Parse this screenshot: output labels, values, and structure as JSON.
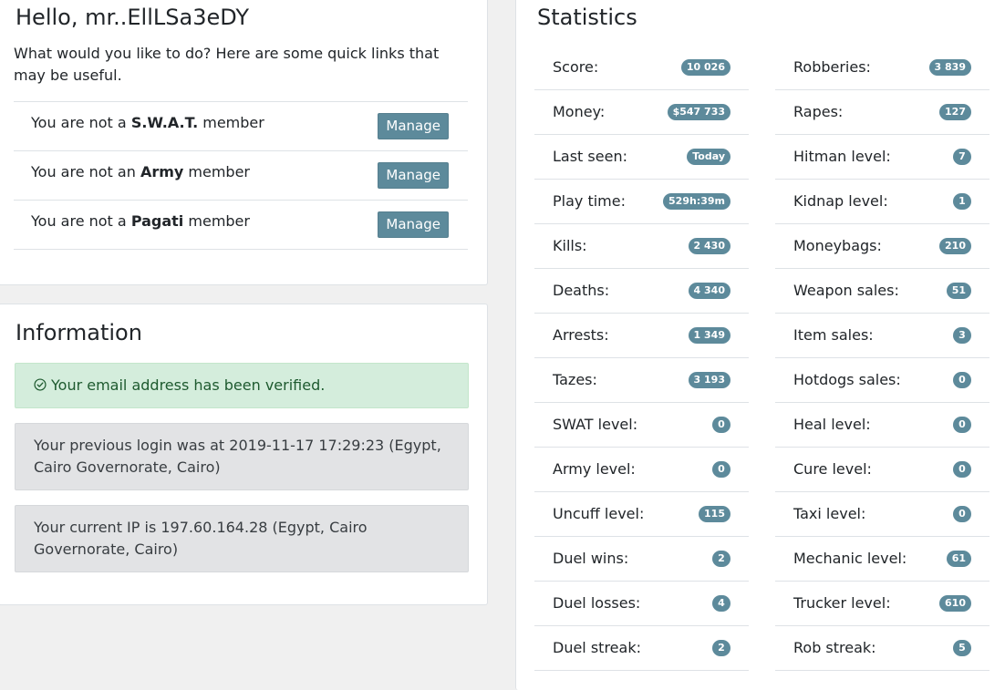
{
  "hello": {
    "title": "Hello, mr..EllLSa3eDY",
    "intro": "What would you like to do? Here are some quick links that may be useful.",
    "memberships": [
      {
        "prefix": "You are not a ",
        "group": "S.W.A.T.",
        "suffix": " member",
        "button": "Manage"
      },
      {
        "prefix": "You are not an ",
        "group": "Army",
        "suffix": " member",
        "button": "Manage"
      },
      {
        "prefix": "You are not a ",
        "group": "Pagati",
        "suffix": " member",
        "button": "Manage"
      }
    ]
  },
  "information": {
    "title": "Information",
    "verified_text": "Your email address has been verified.",
    "login_text": "Your previous login was at 2019-11-17 17:29:23 (Egypt, Cairo Governorate, Cairo)",
    "ip_text": "Your current IP is 197.60.164.28 (Egypt, Cairo Governorate, Cairo)",
    "verified_icon": "check-circle-icon",
    "colors": {
      "success_bg": "#d4eddc",
      "success_text": "#1e5a2f",
      "secondary_bg": "#e2e3e5"
    }
  },
  "statistics": {
    "title": "Statistics",
    "badge_color": "#5d8a9b",
    "left": [
      {
        "label": "Score:",
        "value": "10 026"
      },
      {
        "label": "Money:",
        "value": "$547 733"
      },
      {
        "label": "Last seen:",
        "value": "Today"
      },
      {
        "label": "Play time:",
        "value": "529h:39m"
      },
      {
        "label": "Kills:",
        "value": "2 430"
      },
      {
        "label": "Deaths:",
        "value": "4 340"
      },
      {
        "label": "Arrests:",
        "value": "1 349"
      },
      {
        "label": "Tazes:",
        "value": "3 193"
      },
      {
        "label": "SWAT level:",
        "value": "0"
      },
      {
        "label": "Army level:",
        "value": "0"
      },
      {
        "label": "Uncuff level:",
        "value": "115"
      },
      {
        "label": "Duel wins:",
        "value": "2"
      },
      {
        "label": "Duel losses:",
        "value": "4"
      },
      {
        "label": "Duel streak:",
        "value": "2"
      }
    ],
    "right": [
      {
        "label": "Robberies:",
        "value": "3 839"
      },
      {
        "label": "Rapes:",
        "value": "127"
      },
      {
        "label": "Hitman level:",
        "value": "7"
      },
      {
        "label": "Kidnap level:",
        "value": "1"
      },
      {
        "label": "Moneybags:",
        "value": "210"
      },
      {
        "label": "Weapon sales:",
        "value": "51"
      },
      {
        "label": "Item sales:",
        "value": "3"
      },
      {
        "label": "Hotdogs sales:",
        "value": "0"
      },
      {
        "label": "Heal level:",
        "value": "0"
      },
      {
        "label": "Cure level:",
        "value": "0"
      },
      {
        "label": "Taxi level:",
        "value": "0"
      },
      {
        "label": "Mechanic level:",
        "value": "61"
      },
      {
        "label": "Trucker level:",
        "value": "610"
      },
      {
        "label": "Rob streak:",
        "value": "5"
      }
    ]
  }
}
